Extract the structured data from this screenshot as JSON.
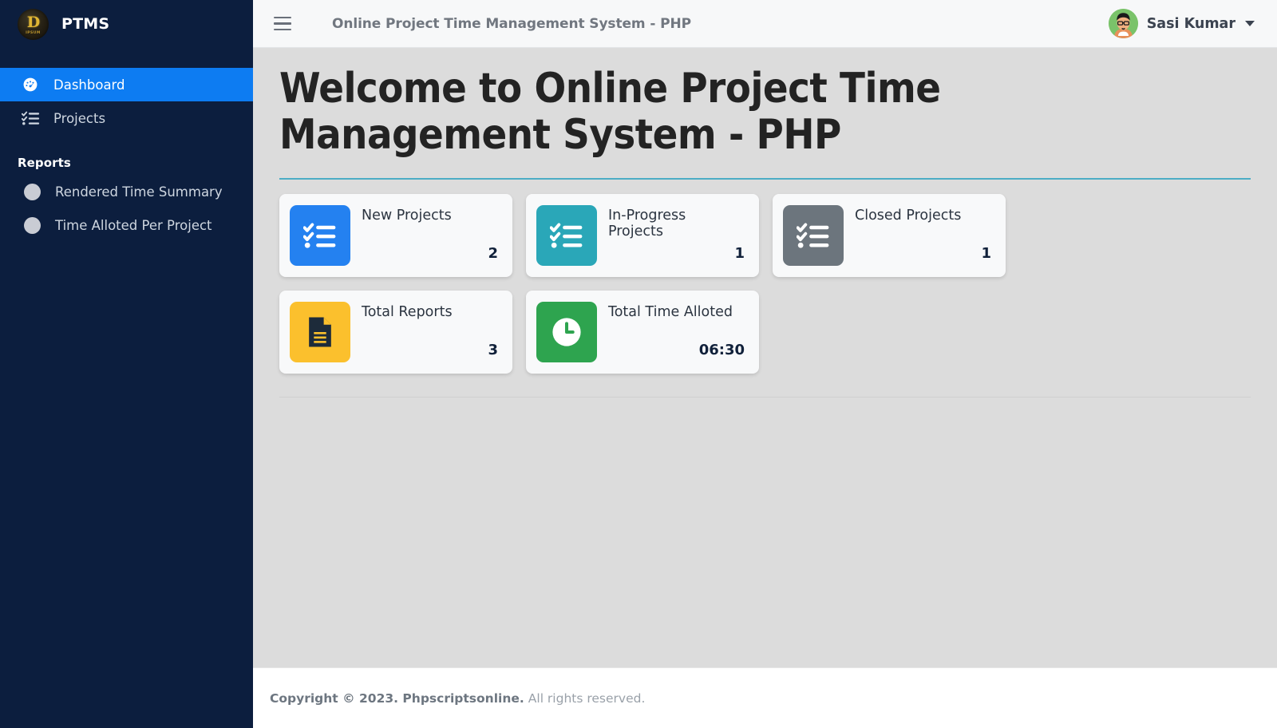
{
  "sidebar": {
    "brand": {
      "name": "PTMS",
      "logo_icon": "ptms-coin-logo",
      "logo_mono": "D",
      "logo_sub": "IPSUM"
    },
    "items": [
      {
        "label": "Dashboard",
        "icon": "speedometer-icon",
        "active": true
      },
      {
        "label": "Projects",
        "icon": "task-list-icon",
        "active": false
      }
    ],
    "reports_heading": "Reports",
    "reports": [
      {
        "label": "Rendered Time Summary",
        "icon": "circle-bullet-icon"
      },
      {
        "label": "Time Alloted Per Project",
        "icon": "circle-bullet-icon"
      }
    ],
    "colors": {
      "background": "#0c1e3e",
      "active": "#0d7cf2",
      "text": "#ced6e0"
    }
  },
  "topbar": {
    "menu_icon": "hamburger-icon",
    "title": "Online Project Time Management System - PHP",
    "user": {
      "name": "Sasi Kumar",
      "avatar_icon": "user-avatar",
      "caret_icon": "chevron-down-icon"
    }
  },
  "main": {
    "page_title": "Welcome to Online Project Time Management System - PHP",
    "divider_color": "#4cadc5",
    "cards": [
      {
        "label": "New Projects",
        "value": "2",
        "icon": "task-list-icon",
        "color": "#2481f0"
      },
      {
        "label": "In-Progress Projects",
        "value": "1",
        "icon": "task-list-icon",
        "color": "#2aa7b8"
      },
      {
        "label": "Closed Projects",
        "value": "1",
        "icon": "task-list-icon",
        "color": "#6c757d"
      },
      {
        "label": "Total Reports",
        "value": "3",
        "icon": "document-icon",
        "color": "#fbc02d"
      },
      {
        "label": "Total Time Alloted",
        "value": "06:30",
        "icon": "clock-icon",
        "color": "#2ea44f"
      }
    ]
  },
  "footer": {
    "copyright": "Copyright © 2023. Phpscriptsonline.",
    "rights": "All rights reserved."
  }
}
